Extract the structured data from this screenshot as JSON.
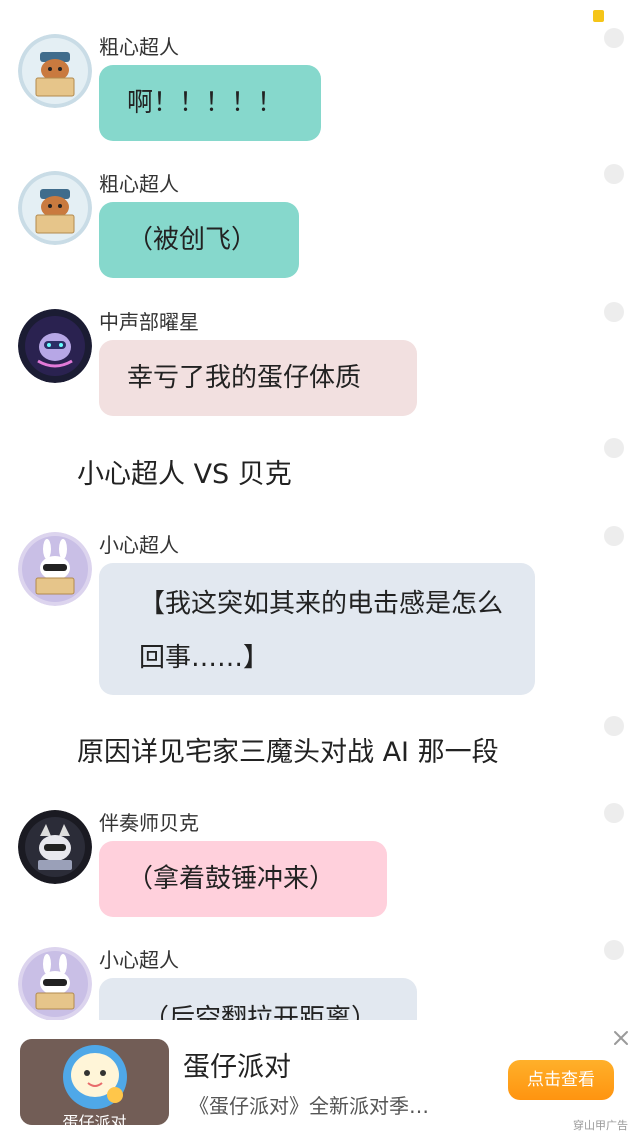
{
  "theme": {
    "teal_bubble": "#86d8cc",
    "pink_bubble": "#f2e0e0",
    "gray_bubble": "#e2e8f0",
    "rose_bubble": "#ffd0dc",
    "ad_button": "#ffa01c"
  },
  "messages": [
    {
      "type": "chat",
      "avatar": "tanuki-police-avatar",
      "name": "粗心超人",
      "text": "啊！！！！！"
    },
    {
      "type": "chat",
      "avatar": "tanuki-police-avatar",
      "name": "粗心超人",
      "text": "（被创飞）"
    },
    {
      "type": "chat",
      "avatar": "purple-robot-avatar",
      "name": "中声部曜星",
      "text": "幸亏了我的蛋仔体质"
    },
    {
      "type": "narration",
      "text": "小心超人 VS 贝克"
    },
    {
      "type": "chat",
      "avatar": "bunny-mask-avatar",
      "name": "小心超人",
      "text": "【我这突如其来的电击感是怎么回事……】"
    },
    {
      "type": "narration",
      "text": "原因详见宅家三魔头对战 AI 那一段"
    },
    {
      "type": "chat",
      "avatar": "dark-cat-avatar",
      "name": "伴奏师贝克",
      "text": "（拿着鼓锤冲来）"
    },
    {
      "type": "chat",
      "avatar": "bunny-mask-avatar",
      "name": "小心超人",
      "text": "（后空翻拉开距离）"
    }
  ],
  "ad": {
    "thumb_label": "蛋仔派对",
    "title": "蛋仔派对",
    "description": "《蛋仔派对》全新派对季…",
    "button": "点击查看",
    "close_icon": "close-icon",
    "mark": "穿山甲广告"
  }
}
